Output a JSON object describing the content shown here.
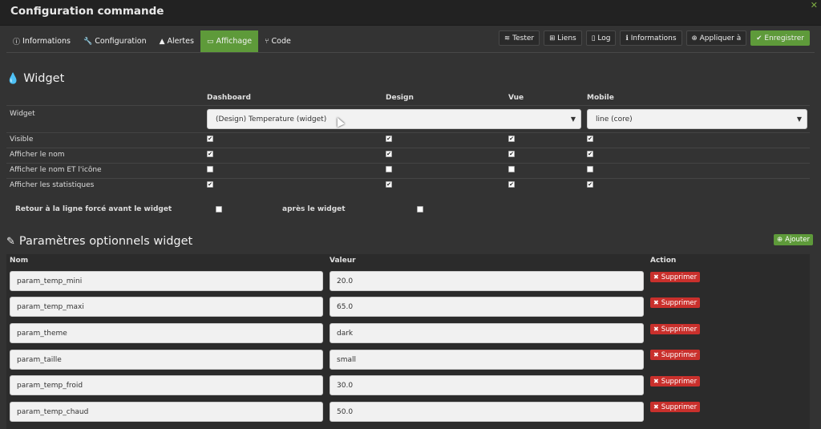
{
  "window": {
    "title": "Configuration commande",
    "close_icon": "close-icon"
  },
  "tabs": [
    {
      "label": "Informations",
      "icon": "ⓘ"
    },
    {
      "label": "Configuration",
      "icon": "🔧"
    },
    {
      "label": "Alertes",
      "icon": "▲"
    },
    {
      "label": "Affichage",
      "icon": "▭",
      "active": true
    },
    {
      "label": "Code",
      "icon": "⑂"
    }
  ],
  "actions": [
    {
      "label": "Tester",
      "icon": "≋"
    },
    {
      "label": "Liens",
      "icon": "⊞"
    },
    {
      "label": "Log",
      "icon": "▯"
    },
    {
      "label": "Informations",
      "icon": "ℹ"
    },
    {
      "label": "Appliquer à",
      "icon": "⊕"
    },
    {
      "label": "Enregistrer",
      "icon": "✔",
      "accent": "#5e9a3a"
    }
  ],
  "widget": {
    "title": "Widget",
    "columns": [
      "Dashboard",
      "Design",
      "Vue",
      "Mobile"
    ],
    "widget_label": "Widget",
    "dashboard_select": "(Design) Temperature (widget)",
    "mobile_select": "line (core)",
    "rows": [
      {
        "label": "Visible",
        "checks": [
          true,
          true,
          true,
          true
        ]
      },
      {
        "label": "Afficher le nom",
        "checks": [
          true,
          true,
          true,
          true
        ]
      },
      {
        "label": "Afficher le nom ET l'icône",
        "checks": [
          false,
          false,
          false,
          false
        ]
      },
      {
        "label": "Afficher les statistiques",
        "checks": [
          true,
          true,
          true,
          true
        ]
      }
    ],
    "break_before_label": "Retour à la ligne forcé avant le widget",
    "break_before": false,
    "break_after_label": "après le widget",
    "break_after": false
  },
  "params": {
    "title": "Paramètres optionnels widget",
    "add_label": "Ajouter",
    "headers": {
      "name": "Nom",
      "value": "Valeur",
      "action": "Action"
    },
    "delete_label": "Supprimer",
    "rows": [
      {
        "name": "param_temp_mini",
        "value": "20.0"
      },
      {
        "name": "param_temp_maxi",
        "value": "65.0"
      },
      {
        "name": "param_theme",
        "value": "dark"
      },
      {
        "name": "param_taille",
        "value": "small"
      },
      {
        "name": "param_temp_froid",
        "value": "30.0"
      },
      {
        "name": "param_temp_chaud",
        "value": "50.0"
      }
    ]
  },
  "colors": {
    "accent_green": "#5e9a3a",
    "danger_red": "#c9302c",
    "background": "#333333"
  }
}
